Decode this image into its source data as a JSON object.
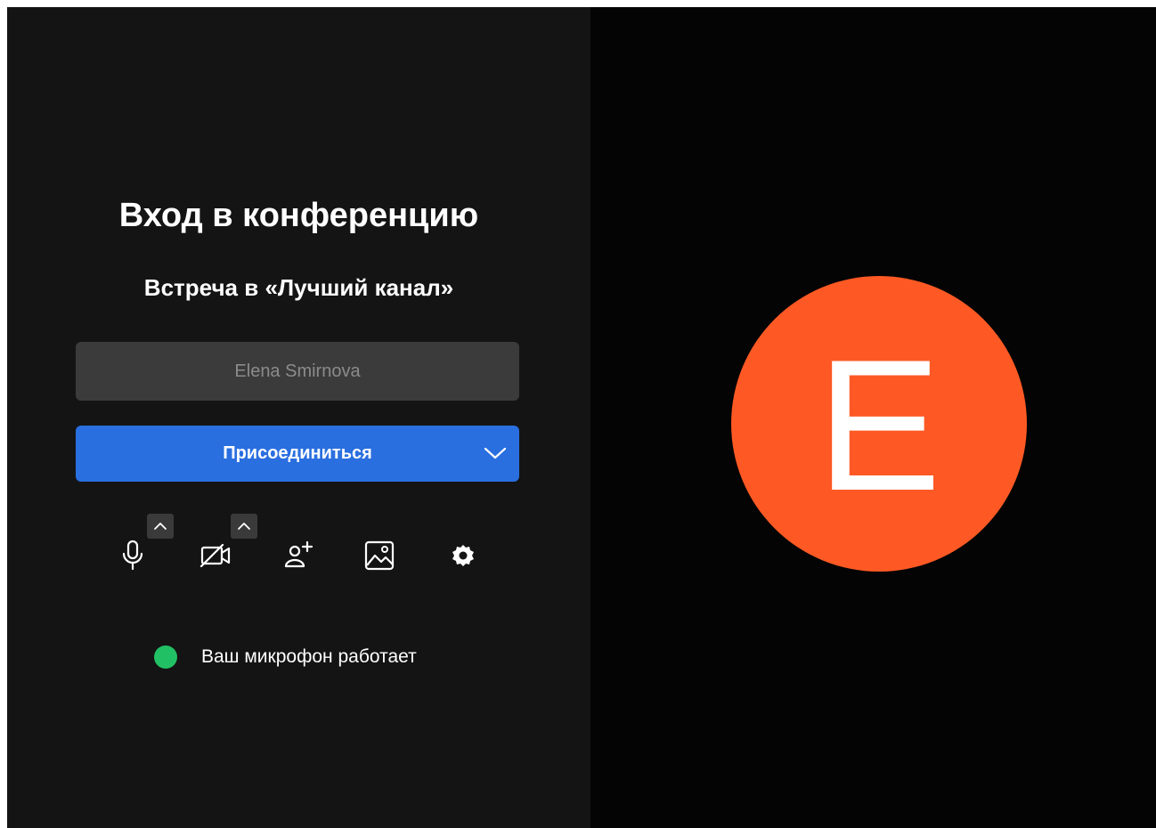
{
  "join_panel": {
    "title": "Вход в конференцию",
    "subtitle": "Встреча в «Лучший канал»",
    "name_input": {
      "value": "",
      "placeholder": "Elena Smirnova"
    },
    "join_button": {
      "label": "Присоединиться",
      "dropdown_icon": "chevron-down-icon"
    },
    "controls": [
      {
        "name": "microphone",
        "icon": "microphone-icon",
        "has_options": true
      },
      {
        "name": "camera",
        "icon": "camera-off-icon",
        "has_options": true
      },
      {
        "name": "invite",
        "icon": "add-user-icon",
        "has_options": false
      },
      {
        "name": "background",
        "icon": "image-icon",
        "has_options": false
      },
      {
        "name": "settings",
        "icon": "gear-icon",
        "has_options": false
      }
    ],
    "mic_status": {
      "text": "Ваш микрофон работает",
      "indicator_color": "#22c064"
    }
  },
  "preview": {
    "avatar_letter": "E",
    "avatar_color": "#fe5924"
  },
  "colors": {
    "left_bg": "#141414",
    "right_bg": "#040404",
    "accent": "#2a6fe0",
    "input_bg": "#3b3b3b"
  }
}
